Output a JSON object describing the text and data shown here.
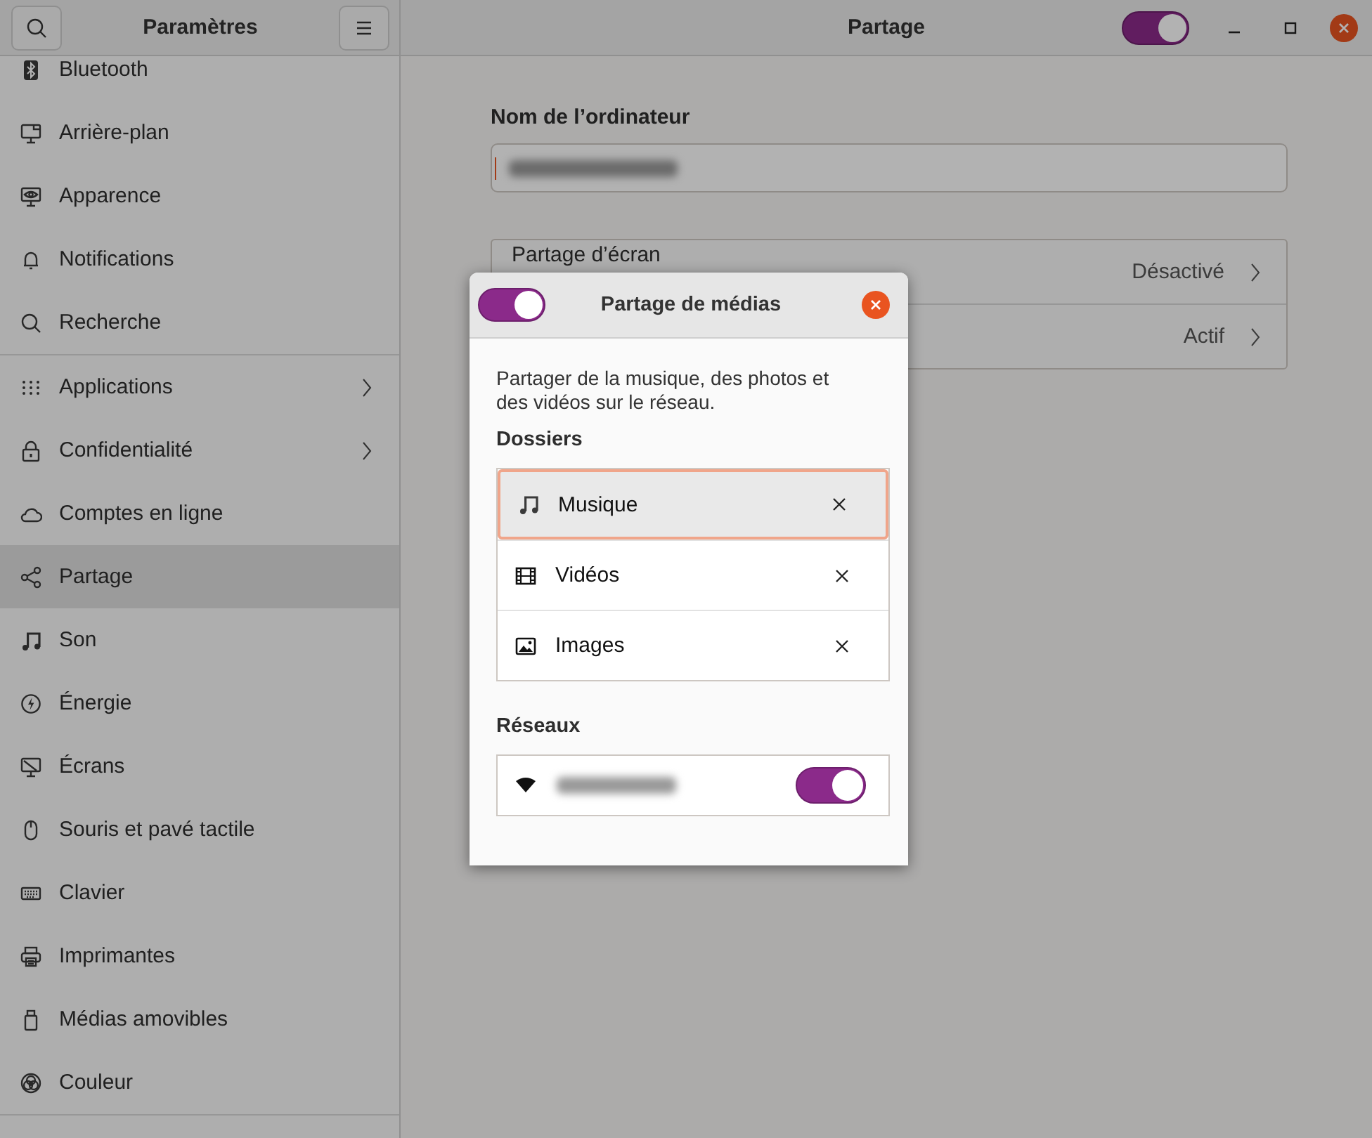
{
  "header": {
    "sidebar_title": "Paramètres",
    "title": "Partage",
    "sharing_switch": {
      "on": true
    }
  },
  "sidebar": {
    "groups": [
      [
        {
          "label": "Bluetooth",
          "selected": false,
          "chevron": false
        },
        {
          "label": "Arrière-plan",
          "selected": false,
          "chevron": false
        },
        {
          "label": "Apparence",
          "selected": false,
          "chevron": false
        },
        {
          "label": "Notifications",
          "selected": false,
          "chevron": false
        },
        {
          "label": "Recherche",
          "selected": false,
          "chevron": false
        }
      ],
      [
        {
          "label": "Applications",
          "selected": false,
          "chevron": true
        },
        {
          "label": "Confidentialité",
          "selected": false,
          "chevron": true
        },
        {
          "label": "Comptes en ligne",
          "selected": false,
          "chevron": false
        },
        {
          "label": "Partage",
          "selected": true,
          "chevron": false
        },
        {
          "label": "Son",
          "selected": false,
          "chevron": false
        },
        {
          "label": "Énergie",
          "selected": false,
          "chevron": false
        },
        {
          "label": "Écrans",
          "selected": false,
          "chevron": false
        },
        {
          "label": "Souris et pavé tactile",
          "selected": false,
          "chevron": false
        },
        {
          "label": "Clavier",
          "selected": false,
          "chevron": false
        },
        {
          "label": "Imprimantes",
          "selected": false,
          "chevron": false
        },
        {
          "label": "Médias amovibles",
          "selected": false,
          "chevron": false
        },
        {
          "label": "Couleur",
          "selected": false,
          "chevron": false
        }
      ]
    ]
  },
  "computer_name": {
    "label": "Nom de l’ordinateur"
  },
  "services": [
    {
      "label": "Partage d’écran",
      "status": "Désactivé"
    },
    {
      "status": "Actif"
    }
  ],
  "dialog": {
    "title": "Partage de médias",
    "enabled": true,
    "description": "Partager de la musique, des photos et des vidéos sur le réseau.",
    "folders_heading": "Dossiers",
    "folders": [
      {
        "label": "Musique",
        "selected": true
      },
      {
        "label": "Vidéos",
        "selected": false
      },
      {
        "label": "Images",
        "selected": false
      }
    ],
    "networks_heading": "Réseaux",
    "networks": [
      {
        "on": true
      }
    ]
  }
}
